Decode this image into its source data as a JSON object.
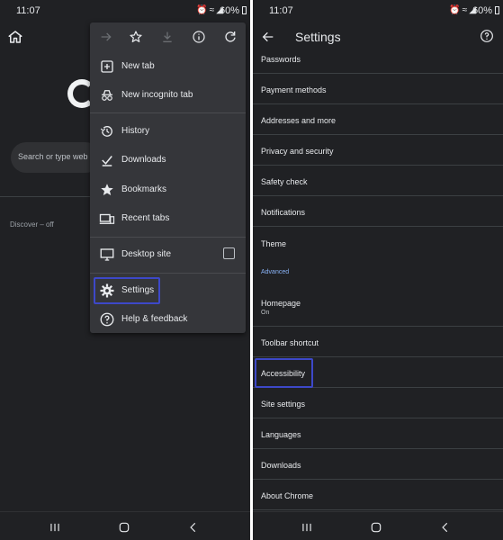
{
  "left": {
    "status": {
      "time": "11:07",
      "battery": "60%"
    },
    "search": {
      "placeholder": "Search or type web a"
    },
    "discover": "Discover – off",
    "menu": {
      "toolbar_icons": [
        "forward-icon",
        "star-icon",
        "download-icon",
        "info-icon",
        "refresh-icon"
      ],
      "items": [
        {
          "label": "New tab",
          "icon": "new-tab-icon"
        },
        {
          "label": "New incognito tab",
          "icon": "incognito-icon"
        },
        {
          "label": "History",
          "icon": "history-icon"
        },
        {
          "label": "Downloads",
          "icon": "downloads-icon"
        },
        {
          "label": "Bookmarks",
          "icon": "bookmark-star-icon"
        },
        {
          "label": "Recent tabs",
          "icon": "devices-icon"
        },
        {
          "label": "Desktop site",
          "icon": "monitor-icon",
          "checked": false
        },
        {
          "label": "Settings",
          "icon": "gear-icon",
          "highlighted": true
        },
        {
          "label": "Help & feedback",
          "icon": "help-icon"
        }
      ]
    }
  },
  "right": {
    "status": {
      "time": "11:07",
      "battery": "60%"
    },
    "title": "Settings",
    "items": [
      {
        "label": "Passwords"
      },
      {
        "label": "Payment methods"
      },
      {
        "label": "Addresses and more"
      },
      {
        "label": "Privacy and security"
      },
      {
        "label": "Safety check"
      },
      {
        "label": "Notifications"
      },
      {
        "label": "Theme"
      },
      {
        "label": "Homepage",
        "sub": "On"
      },
      {
        "label": "Toolbar shortcut"
      },
      {
        "label": "Accessibility",
        "highlighted": true
      },
      {
        "label": "Site settings"
      },
      {
        "label": "Languages"
      },
      {
        "label": "Downloads"
      },
      {
        "label": "About Chrome"
      }
    ],
    "advanced_header": "Advanced"
  },
  "colors": {
    "background": "#202124",
    "menu": "#35363a",
    "text": "#e8eaed",
    "accent": "#8ab4f8",
    "highlight_box": "#3d48c8"
  }
}
